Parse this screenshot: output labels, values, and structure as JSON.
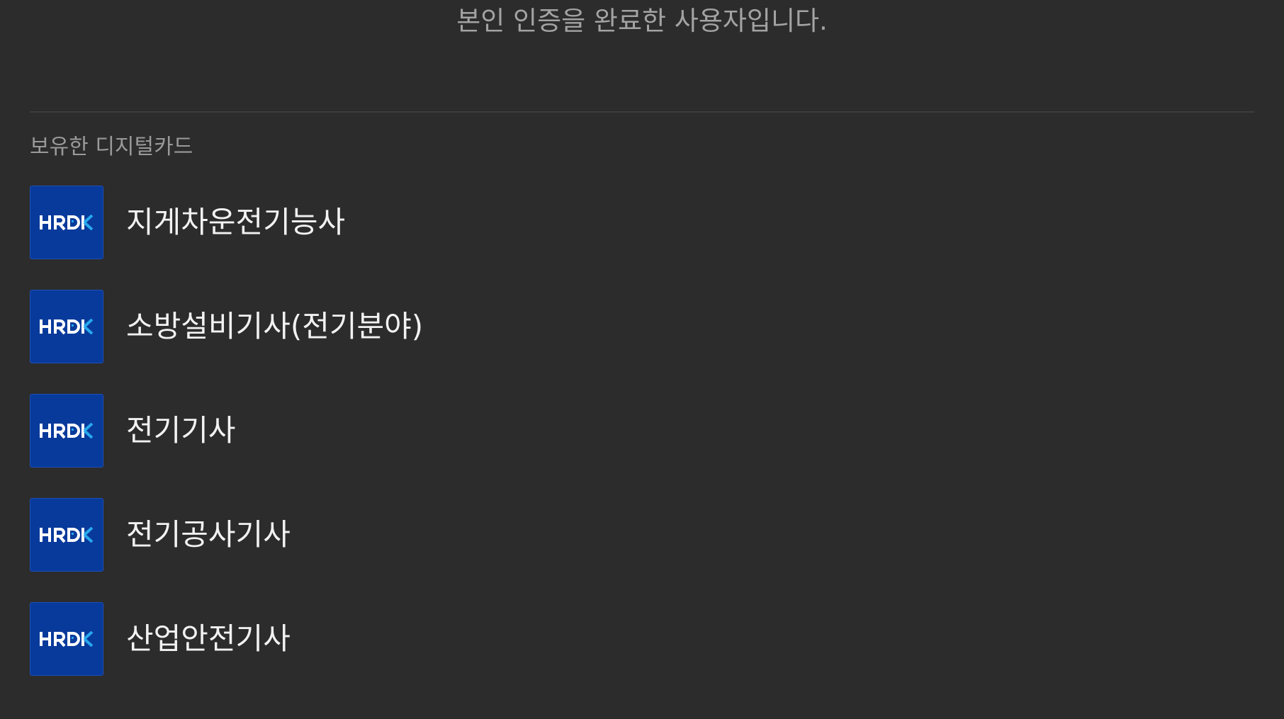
{
  "status_message": "본인 인증을 완료한 사용자입니다.",
  "section": {
    "title": "보유한 디지털카드"
  },
  "logo": {
    "text": "HRDK",
    "background": "#083a9b",
    "letter_color": "#ffffff",
    "accent_color": "#29a8ec"
  },
  "cards": [
    {
      "name": "지게차운전기능사"
    },
    {
      "name": "소방설비기사(전기분야)"
    },
    {
      "name": "전기기사"
    },
    {
      "name": "전기공사기사"
    },
    {
      "name": "산업안전기사"
    }
  ]
}
